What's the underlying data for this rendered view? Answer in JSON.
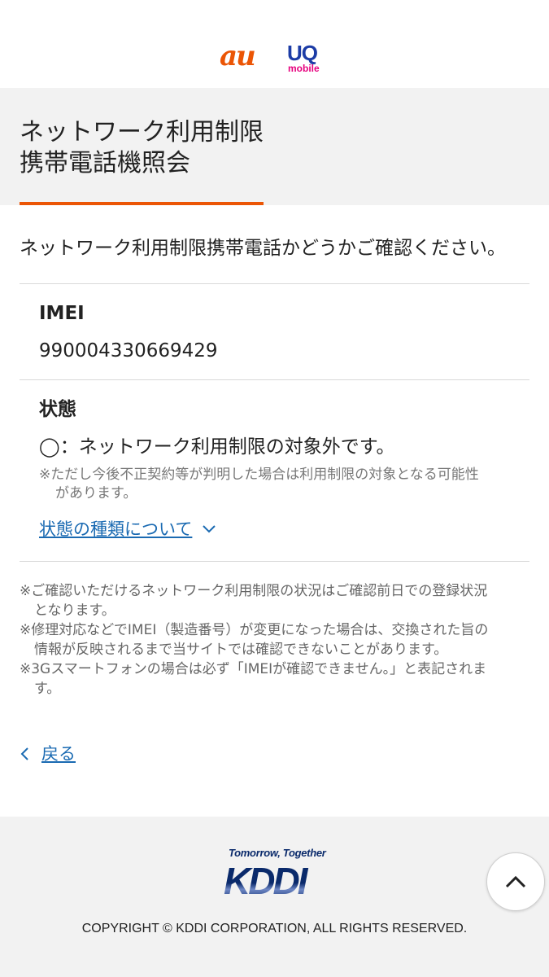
{
  "header": {
    "logo_au": "au",
    "logo_uq": "UQ",
    "logo_uq_sub": "mobile"
  },
  "page": {
    "title_line1": "ネットワーク利用制限",
    "title_line2": "携帯電話機照会"
  },
  "intro": "ネットワーク利用制限携帯電話かどうかご確認ください。",
  "imei": {
    "label": "IMEI",
    "value": "990004330669429"
  },
  "status": {
    "label": "状態",
    "value": "◯：ネットワーク利用制限の対象外です。",
    "note_line1": "※ただし今後不正契約等が判明した場合は利用制限の対象となる可能性",
    "note_line2": "があります。",
    "link_types": "状態の種類について"
  },
  "notes": [
    {
      "first": "※ご確認いただけるネットワーク利用制限の状況はご確認前日での登録状況",
      "rest": "となります。"
    },
    {
      "first": "※修理対応などでIMEI（製造番号）が変更になった場合は、交換された旨の",
      "rest": "情報が反映されるまで当サイトでは確認できないことがあります。"
    },
    {
      "first": "※3Gスマートフォンの場合は必ず「IMEIが確認できません。」と表記されま",
      "rest": "す。"
    }
  ],
  "back_label": "戻る",
  "footer": {
    "tagline": "Tomorrow, Together",
    "brand": "KDDI",
    "copyright": "COPYRIGHT © KDDI CORPORATION, ALL RIGHTS RESERVED."
  },
  "icons": {
    "chevron_down": "chevron-down-icon",
    "chevron_left": "chevron-left-icon",
    "chevron_up": "chevron-up-icon"
  },
  "colors": {
    "accent_orange": "#eb5505",
    "link_blue": "#1a6ab2",
    "band_gray": "#f2f2f2",
    "kddi_navy": "#0a2a6b"
  }
}
